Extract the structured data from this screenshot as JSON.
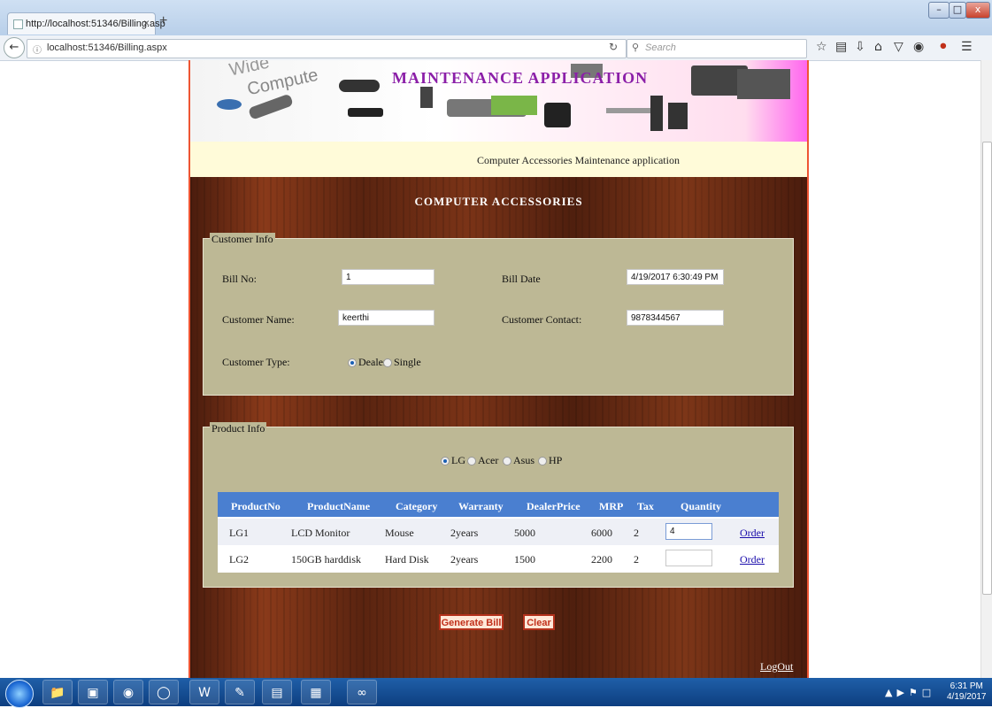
{
  "browser": {
    "tab_title": "http://localhost:51346/Billing.asp",
    "tab_close": "×",
    "new_tab": "+",
    "url": "localhost:51346/Billing.aspx",
    "search_placeholder": "Search",
    "win_minimize": "–",
    "win_maximize": "□",
    "win_close": "x"
  },
  "banner": {
    "title": "MAINTENANCE APPLICATION",
    "art_text_1": "Wide",
    "art_text_2": "Compute",
    "subtitle": "Computer Accessories Maintenance application"
  },
  "heading": "COMPUTER ACCESSORIES",
  "customer_info": {
    "legend": "Customer Info",
    "bill_no_label": "Bill No:",
    "bill_no_value": "1",
    "bill_date_label": "Bill Date",
    "bill_date_value": "4/19/2017 6:30:49 PM",
    "customer_name_label": "Customer Name:",
    "customer_name_value": "keerthi",
    "customer_contact_label": "Customer Contact:",
    "customer_contact_value": "9878344567",
    "customer_type_label": "Customer Type:",
    "customer_type_options": [
      "Dealer",
      "Single"
    ],
    "customer_type_selected": "Dealer"
  },
  "product_info": {
    "legend": "Product Info",
    "brand_options": [
      "LG",
      "Acer",
      "Asus",
      "HP"
    ],
    "brand_selected": "LG",
    "columns": [
      "ProductNo",
      "ProductName",
      "Category",
      "Warranty",
      "DealerPrice",
      "MRP",
      "Tax",
      "Quantity"
    ],
    "rows": [
      {
        "product_no": "LG1",
        "product_name": "LCD Monitor",
        "category": "Mouse",
        "warranty": "2years",
        "dealer_price": "5000",
        "mrp": "6000",
        "tax": "2",
        "quantity": "4",
        "action": "Order"
      },
      {
        "product_no": "LG2",
        "product_name": "150GB harddisk",
        "category": "Hard Disk",
        "warranty": "2years",
        "dealer_price": "1500",
        "mrp": "2200",
        "tax": "2",
        "quantity": "",
        "action": "Order"
      }
    ]
  },
  "buttons": {
    "generate_bill": "Generate Bill",
    "clear": "Clear",
    "logout": "LogOut"
  },
  "taskbar": {
    "time": "6:31 PM",
    "date": "4/19/2017",
    "items": [
      "folder-icon",
      "outlook-icon",
      "firefox-icon",
      "chrome-icon",
      "word-icon",
      "paint-icon",
      "notepad-icon",
      "excel-icon",
      "visual-studio-icon"
    ]
  },
  "colors": {
    "grid_header": "#4a7fd0",
    "fieldset_bg": "#bdb895",
    "banner_title": "#8b1fa8",
    "button_border": "#b3311b",
    "page_border": "#ee5533"
  }
}
